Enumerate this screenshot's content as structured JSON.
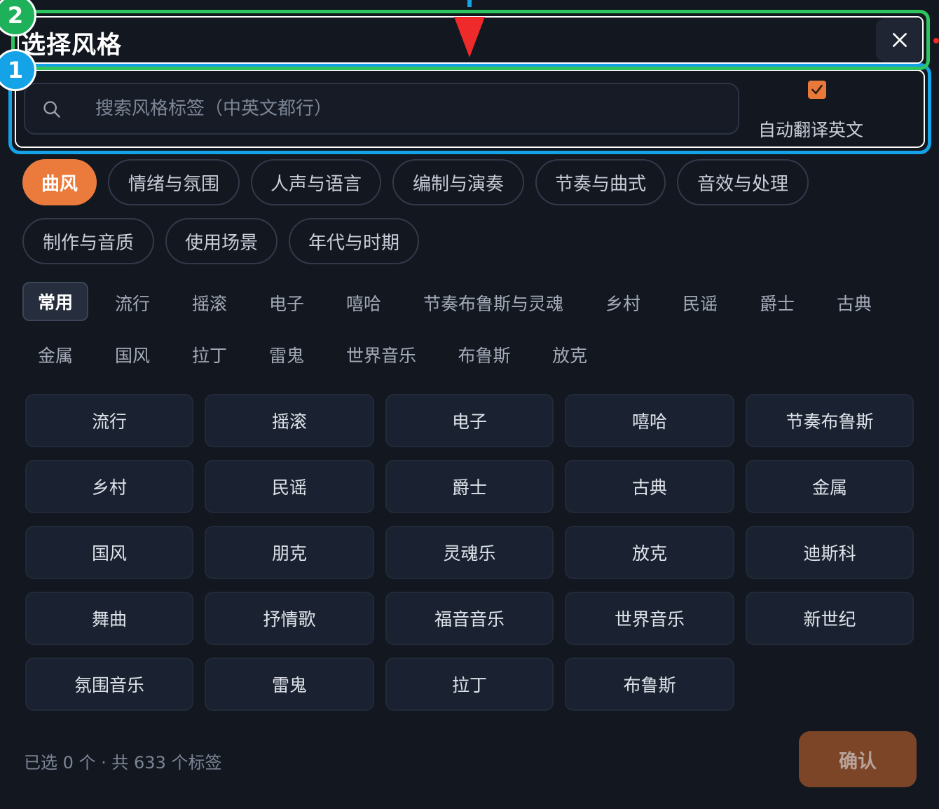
{
  "header": {
    "title": "选择风格"
  },
  "annotations": {
    "badge_1": "1",
    "badge_2": "2"
  },
  "search": {
    "placeholder": "搜索风格标签（中英文都行）",
    "value": ""
  },
  "auto_translate": {
    "label": "自动翻译英文",
    "checked": true
  },
  "categories": [
    {
      "label": "曲风",
      "active": true
    },
    {
      "label": "情绪与氛围"
    },
    {
      "label": "人声与语言"
    },
    {
      "label": "编制与演奏"
    },
    {
      "label": "节奏与曲式"
    },
    {
      "label": "音效与处理"
    },
    {
      "label": "制作与音质"
    },
    {
      "label": "使用场景"
    },
    {
      "label": "年代与时期"
    }
  ],
  "subcategories": [
    {
      "label": "常用",
      "active": true
    },
    {
      "label": "流行"
    },
    {
      "label": "摇滚"
    },
    {
      "label": "电子"
    },
    {
      "label": "嘻哈"
    },
    {
      "label": "节奏布鲁斯与灵魂"
    },
    {
      "label": "乡村"
    },
    {
      "label": "民谣"
    },
    {
      "label": "爵士"
    },
    {
      "label": "古典"
    },
    {
      "label": "金属"
    },
    {
      "label": "国风"
    },
    {
      "label": "拉丁"
    },
    {
      "label": "雷鬼"
    },
    {
      "label": "世界音乐"
    },
    {
      "label": "布鲁斯"
    },
    {
      "label": "放克"
    }
  ],
  "tags": [
    "流行",
    "摇滚",
    "电子",
    "嘻哈",
    "节奏布鲁斯",
    "乡村",
    "民谣",
    "爵士",
    "古典",
    "金属",
    "国风",
    "朋克",
    "灵魂乐",
    "放克",
    "迪斯科",
    "舞曲",
    "抒情歌",
    "福音音乐",
    "世界音乐",
    "新世纪",
    "氛围音乐",
    "雷鬼",
    "拉丁",
    "布鲁斯"
  ],
  "footer": {
    "count_text": "已选 0 个 · 共 633 个标签",
    "confirm_label": "确认"
  },
  "colors": {
    "accent": "#ea7b3c",
    "background": "#121720",
    "annotation_green": "#2ec55e",
    "annotation_blue": "#13a3e6",
    "annotation_red": "#ee2a2a"
  }
}
